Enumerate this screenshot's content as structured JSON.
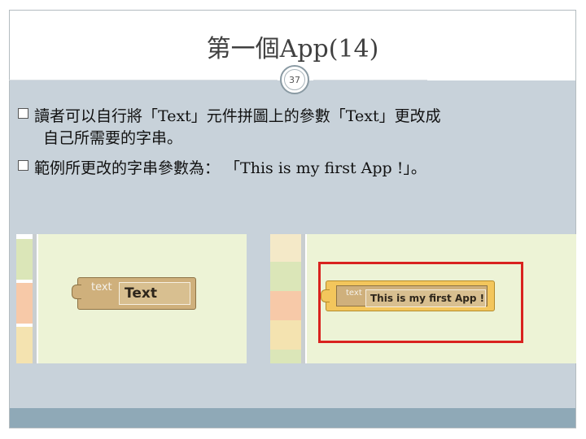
{
  "slide": {
    "title": "第一個App(14)",
    "page_number": "37"
  },
  "bullets": [
    {
      "line1": "讀者可以自行將「Text」元件拼圖上的參數「Text」更改成",
      "line2": "自己所需要的字串。"
    },
    {
      "line1": "範例所更改的字串參數為： 「This is my first App !」。"
    }
  ],
  "screenshots": {
    "before": {
      "block_label": "text",
      "field_value": "Text"
    },
    "after": {
      "block_label": "text",
      "field_value": "This is my first App !"
    }
  },
  "colors": {
    "content_bg": "#c8d2da",
    "footer_bar": "#8fa9b7",
    "highlight_border": "#d9221f",
    "block_fill": "#cfb07c",
    "selected_block": "#f3c65c"
  }
}
